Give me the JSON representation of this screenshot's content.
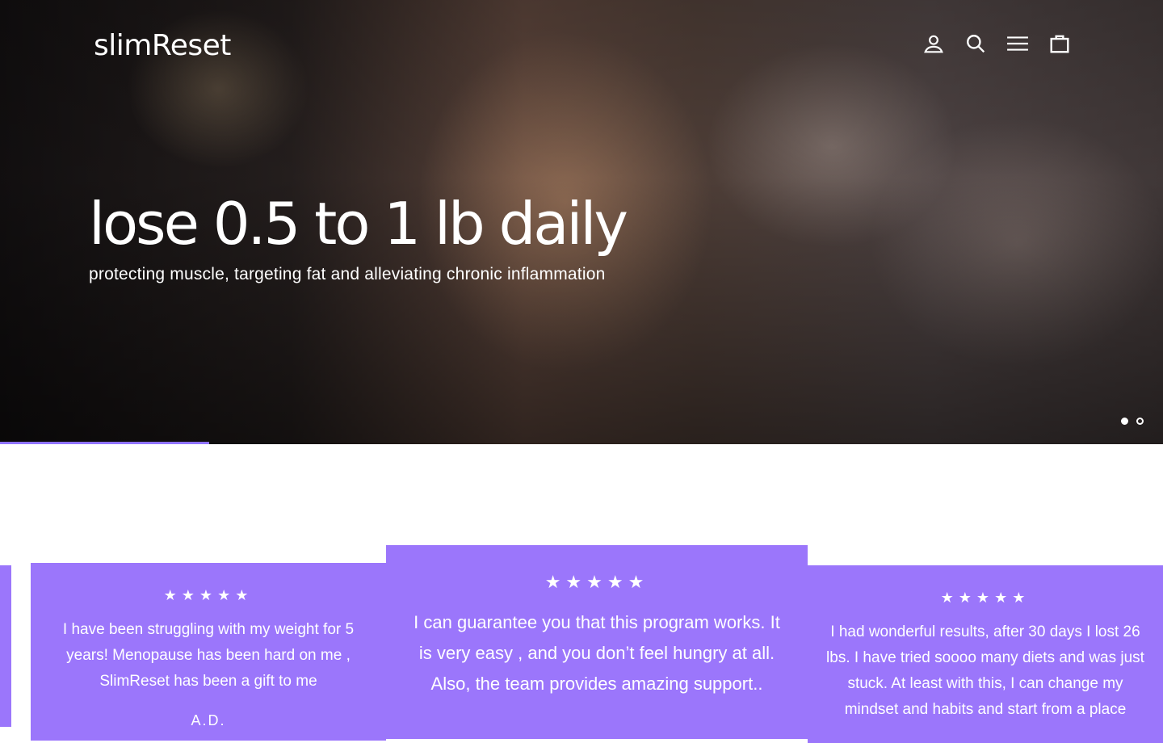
{
  "header": {
    "logo": "slimReset",
    "icons": [
      "account-icon",
      "search-icon",
      "menu-icon",
      "cart-icon"
    ]
  },
  "hero": {
    "title": "lose 0.5 to 1 lb daily",
    "subtitle": "protecting muscle, targeting fat and alleviating chronic inflammation",
    "slide_count": 2,
    "active_slide": 1,
    "progress": 0.18
  },
  "testimonials": [
    {
      "stars": "★★★★★",
      "text": "I have been struggling with my weight for 5 years! Menopause has been hard on me , SlimReset has been a gift to me",
      "author": "A.D."
    },
    {
      "stars": "★★★★★",
      "text": "I can guarantee you that this program works. It is very easy , and you don’t feel hungry at all. Also, the team provides amazing support.."
    },
    {
      "stars": "★★★★★",
      "text": "I had wonderful results, after 30 days I lost 26 lbs. I have tried soooo many diets and was just stuck. At least with this, I can change my mindset and habits and start from a place"
    }
  ],
  "colors": {
    "accent": "#9b76fb",
    "progress": "#8f73ff"
  }
}
